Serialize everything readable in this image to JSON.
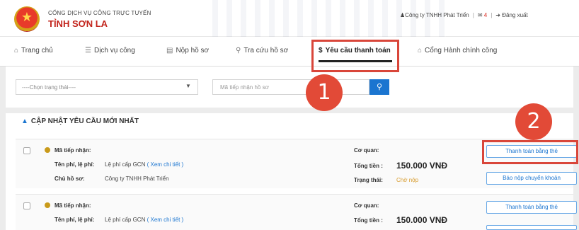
{
  "header": {
    "brand_sub": "CỔNG DỊCH VỤ CÔNG TRỰC TUYẾN",
    "brand_main": "TỈNH SƠN LA",
    "user": "Công ty TNHH Phát Triển",
    "messages": "4",
    "logout": "Đăng xuất"
  },
  "nav": {
    "items": [
      {
        "label": "Trang chủ",
        "icon": "home-icon"
      },
      {
        "label": "Dịch vụ công",
        "icon": "list-icon"
      },
      {
        "label": "Nộp hồ sơ",
        "icon": "document-icon"
      },
      {
        "label": "Tra cứu hồ sơ",
        "icon": "search-icon"
      },
      {
        "label": "Yêu cầu thanh toán",
        "icon": "dollar-icon"
      },
      {
        "label": "Cổng Hành chính công",
        "icon": "bank-icon"
      }
    ],
    "active_index": 4
  },
  "filter": {
    "status_selected": "----Chọn trạng thái----",
    "search_placeholder": "Mã tiếp nhận hồ sơ"
  },
  "panel": {
    "title": "CẬP NHẬT YÊU CẦU MỚI NHẤT",
    "labels": {
      "receipt": "Mã tiếp nhận:",
      "fee": "Tên phí, lệ phí:",
      "owner": "Chủ hồ sơ:",
      "agency": "Cơ quan:",
      "total": "Tổng tiền :",
      "status": "Trạng thái:"
    },
    "rows": [
      {
        "fee_name": "Lệ phí cấp GCN",
        "detail_link": "( Xem chi tiết )",
        "owner": "Công ty TNHH Phát Triển",
        "total": "150.000 VNĐ",
        "status": "Chờ nộp",
        "btn_card": "Thanh toán bằng thẻ",
        "btn_transfer": "Báo nộp chuyển khoản"
      },
      {
        "fee_name": "Lệ phí cấp GCN",
        "detail_link": "( Xem chi tiết )",
        "total": "150.000 VNĐ",
        "btn_card": "Thanh toán bằng thẻ"
      }
    ]
  },
  "callouts": {
    "one": "1",
    "two": "2"
  },
  "colors": {
    "accent": "#1b75d0",
    "brand_red": "#c2231b",
    "callout": "#e24a37",
    "status": "#d79a2a"
  }
}
